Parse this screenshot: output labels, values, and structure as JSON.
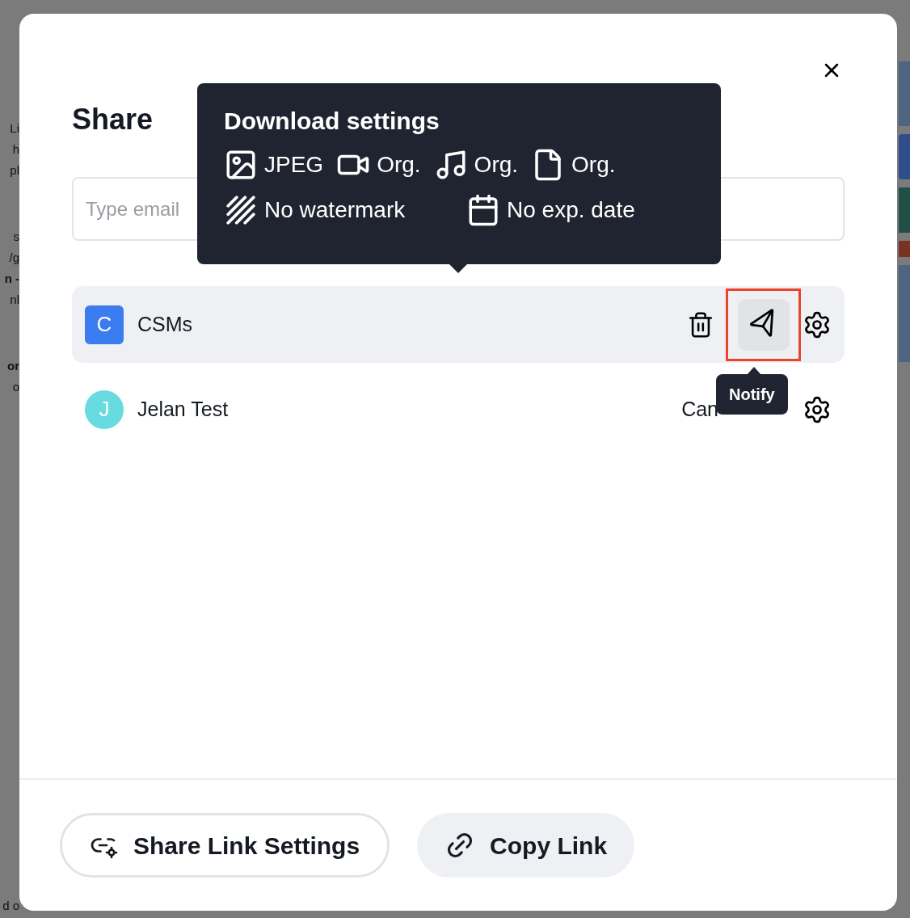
{
  "background": {
    "fragment_groups": [
      [
        {
          "text": "Li",
          "bold": false
        },
        {
          "text": "h",
          "bold": false
        },
        {
          "text": "pl",
          "bold": false
        }
      ],
      [
        {
          "text": "s",
          "bold": false
        },
        {
          "text": "/g",
          "bold": false
        },
        {
          "text": "n -",
          "bold": true
        },
        {
          "text": "nl",
          "bold": false
        }
      ],
      [
        {
          "text": "or",
          "bold": true
        },
        {
          "text": "o",
          "bold": false
        }
      ]
    ],
    "bottom_fragment": "d o"
  },
  "dialog": {
    "title": "Share",
    "email_field": {
      "placeholder": "Type email"
    },
    "members": [
      {
        "initial": "C",
        "name": "CSMs",
        "kind": "group",
        "color": "#3b7cf0",
        "selected": true
      },
      {
        "initial": "J",
        "name": "Jelan Test",
        "kind": "user",
        "color": "#67dbe0",
        "selected": false,
        "access": "Can"
      }
    ],
    "notify_button": {
      "highlighted": true
    },
    "download_tooltip": {
      "title": "Download settings",
      "items": [
        {
          "kind": "image",
          "text": "JPEG"
        },
        {
          "kind": "video",
          "text": "Org."
        },
        {
          "kind": "audio",
          "text": "Org."
        },
        {
          "kind": "document",
          "text": "Org."
        },
        {
          "kind": "watermark",
          "text": "No watermark"
        },
        {
          "kind": "calendar",
          "text": "No exp. date"
        }
      ]
    },
    "notify_tooltip": {
      "text": "Notify"
    },
    "footer_buttons": [
      {
        "label": "Share Link Settings",
        "kind": "outline"
      },
      {
        "label": "Copy Link",
        "kind": "filled"
      }
    ]
  }
}
